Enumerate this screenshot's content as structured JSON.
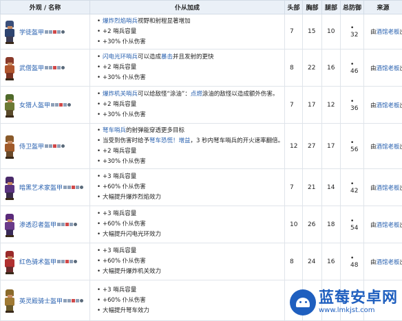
{
  "table": {
    "headers": [
      "外观 / 名称",
      "仆从加成",
      "头部",
      "胸部",
      "腿部",
      "总防御",
      "来源"
    ],
    "rows": [
      {
        "name": "学徒盔甲",
        "effects": [
          [
            {
              "t": "爆炸烈焰哨兵",
              "hl": true
            },
            {
              "t": "视野和射程显著增加",
              "hl": false
            }
          ],
          [
            {
              "t": "+2 哨兵容量",
              "hl": false
            }
          ],
          [
            {
              "t": "+30% 仆从伤害",
              "hl": false
            }
          ]
        ],
        "head": "7",
        "chest": "15",
        "legs": "10",
        "total": "32",
        "source_pre": "由",
        "source_link": "酒馆老板",
        "source_post": "出售",
        "colors": {
          "head": "#3a4f7a",
          "body": "#2e4470",
          "legs": "#3b3b52"
        }
      },
      {
        "name": "武僧盔甲",
        "effects": [
          [
            {
              "t": "闪电光环哨兵",
              "hl": true
            },
            {
              "t": "可以造成",
              "hl": false
            },
            {
              "t": "暴击",
              "hl": true
            },
            {
              "t": "并且发射的更快",
              "hl": false
            }
          ],
          [
            {
              "t": "+2 哨兵容量",
              "hl": false
            }
          ],
          [
            {
              "t": "+30% 仆从伤害",
              "hl": false
            }
          ]
        ],
        "head": "8",
        "chest": "22",
        "legs": "16",
        "total": "46",
        "source_pre": "由",
        "source_link": "酒馆老板",
        "source_post": "出售",
        "colors": {
          "head": "#8a3a2a",
          "body": "#b0552e",
          "legs": "#7a3322"
        }
      },
      {
        "name": "女猎人盔甲",
        "effects": [
          [
            {
              "t": "爆炸机关哨兵",
              "hl": true
            },
            {
              "t": "可以给敌怪“涂油”：",
              "hl": false
            },
            {
              "t": "点燃",
              "hl": true
            },
            {
              "t": "涂油的敌怪以造成额外伤害。",
              "hl": false
            }
          ],
          [
            {
              "t": "+2 哨兵容量",
              "hl": false
            }
          ],
          [
            {
              "t": "+30% 仆从伤害",
              "hl": false
            }
          ]
        ],
        "head": "7",
        "chest": "17",
        "legs": "12",
        "total": "36",
        "source_pre": "由",
        "source_link": "酒馆老板",
        "source_post": "出售",
        "colors": {
          "head": "#4f6a2a",
          "body": "#6b7a33",
          "legs": "#5a4a2a"
        }
      },
      {
        "name": "侍卫盔甲",
        "effects": [
          [
            {
              "t": "弩车哨兵",
              "hl": true
            },
            {
              "t": "的射弹能穿透更多目标",
              "hl": false
            }
          ],
          [
            {
              "t": "当受到伤害时给予",
              "hl": false
            },
            {
              "t": "弩车恐慌！增益",
              "hl": true
            },
            {
              "t": "，3 秒内弩车哨兵的开火速率翻倍。",
              "hl": false
            }
          ],
          [
            {
              "t": "+2 哨兵容量",
              "hl": false
            }
          ],
          [
            {
              "t": "+30% 仆从伤害",
              "hl": false
            }
          ]
        ],
        "head": "12",
        "chest": "27",
        "legs": "17",
        "total": "56",
        "source_pre": "由",
        "source_link": "酒馆老板",
        "source_post": "出售",
        "colors": {
          "head": "#8a5a2a",
          "body": "#a05a2a",
          "legs": "#6a4a2a"
        }
      },
      {
        "name": "暗黑艺术家盔甲",
        "effects": [
          [
            {
              "t": "+3 哨兵容量",
              "hl": false
            }
          ],
          [
            {
              "t": "+60% 仆从伤害",
              "hl": false
            }
          ],
          [
            {
              "t": "大幅提升爆炸烈焰效力",
              "hl": false
            }
          ]
        ],
        "head": "7",
        "chest": "21",
        "legs": "14",
        "total": "42",
        "source_pre": "由",
        "source_link": "酒馆老板",
        "source_post": "出售",
        "colors": {
          "head": "#4a2a6a",
          "body": "#5a3380",
          "legs": "#3a2a4a"
        }
      },
      {
        "name": "渗透忍者盔甲",
        "effects": [
          [
            {
              "t": "+3 哨兵容量",
              "hl": false
            }
          ],
          [
            {
              "t": "+60% 仆从伤害",
              "hl": false
            }
          ],
          [
            {
              "t": "大幅提升闪电光环效力",
              "hl": false
            }
          ]
        ],
        "head": "10",
        "chest": "26",
        "legs": "18",
        "total": "54",
        "source_pre": "由",
        "source_link": "酒馆老板",
        "source_post": "出售",
        "colors": {
          "head": "#5a2a7a",
          "body": "#6a3a8a",
          "legs": "#3a2a5a"
        }
      },
      {
        "name": "红色骑术盔甲",
        "effects": [
          [
            {
              "t": "+3 哨兵容量",
              "hl": false
            }
          ],
          [
            {
              "t": "+60% 仆从伤害",
              "hl": false
            }
          ],
          [
            {
              "t": "大幅提升爆炸机关效力",
              "hl": false
            }
          ]
        ],
        "head": "8",
        "chest": "24",
        "legs": "16",
        "total": "48",
        "source_pre": "由",
        "source_link": "酒馆老板",
        "source_post": "出售",
        "colors": {
          "head": "#9a2a2a",
          "body": "#b03030",
          "legs": "#6a2a2a"
        }
      },
      {
        "name": "英灵殿骑士盔甲",
        "effects": [
          [
            {
              "t": "+3 哨兵容量",
              "hl": false
            }
          ],
          [
            {
              "t": "+60% 仆从伤害",
              "hl": false
            }
          ],
          [
            {
              "t": "大幅提升弩车效力",
              "hl": false
            }
          ]
        ],
        "head": "",
        "chest": "",
        "legs": "",
        "total": "",
        "source_pre": "",
        "source_link": "",
        "source_post": "",
        "colors": {
          "head": "#8a6a2a",
          "body": "#a07a33",
          "legs": "#6a5a2a"
        }
      }
    ]
  },
  "watermark": {
    "title": "蓝莓安卓网",
    "url": "www.lmkjst.com"
  }
}
